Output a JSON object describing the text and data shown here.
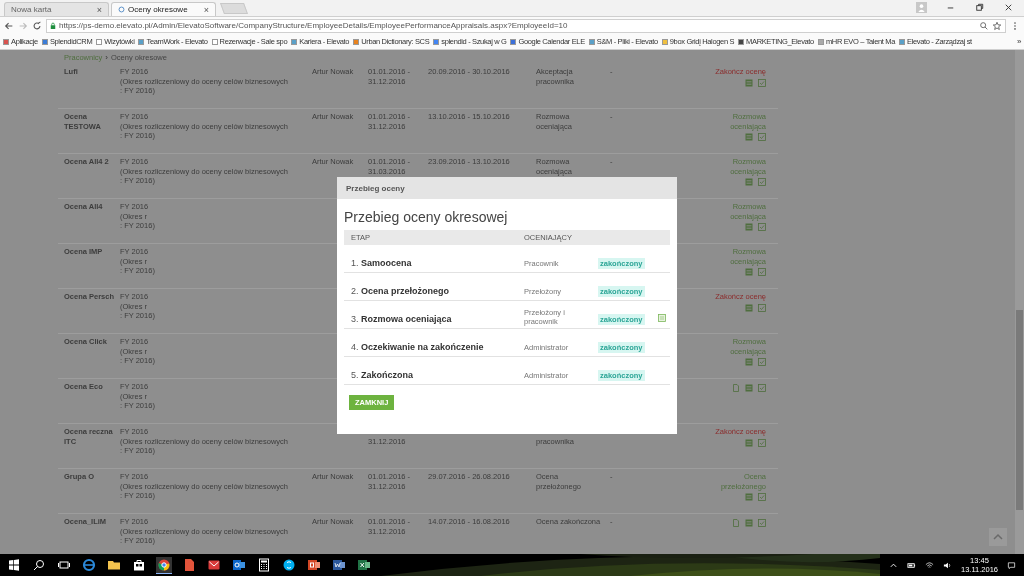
{
  "browser": {
    "tabs": [
      {
        "title": "Nowa karta",
        "close": "×",
        "selected": false
      },
      {
        "title": "Oceny okresowe",
        "close": "×",
        "selected": true
      }
    ],
    "url": "https://ps-demo.elevato.pl/Admin/ElevatoSoftware/CompanyStructure/EmployeeDetails/EmployeePerformanceAppraisals.aspx?EmployeeId=10",
    "bookmarks": [
      {
        "label": "Aplikacje",
        "color": "#d9534f"
      },
      {
        "label": "SplendidCRM",
        "color": "#3b7dd8"
      },
      {
        "label": "Wizytówki",
        "color": "#ffffff"
      },
      {
        "label": "TeamWork - Elevato",
        "color": "#5aa0c8"
      },
      {
        "label": "Rezerwacje - Sale spo",
        "color": "#ffffff"
      },
      {
        "label": "Kariera - Elevato",
        "color": "#5aa0c8"
      },
      {
        "label": "Urban Dictionary: SCS",
        "color": "#e8821e"
      },
      {
        "label": "splendid - Szukaj w G",
        "color": "#4285f4"
      },
      {
        "label": "Google Calendar ELE",
        "color": "#3b6fd8"
      },
      {
        "label": "S&M - Pliki - Elevato",
        "color": "#5aa0c8"
      },
      {
        "label": "9box Gridį Halogen S",
        "color": "#f0c040"
      },
      {
        "label": "MARKETING_Elevato",
        "color": "#444444"
      },
      {
        "label": "mHR EVO – Talent Ma",
        "color": "#aaaaaa"
      },
      {
        "label": "Elevato - Zarządzaj st",
        "color": "#5aa0c8"
      }
    ],
    "more": "»"
  },
  "breadcrumb": {
    "link": "Pracownicy",
    "separator": "›",
    "current": "Oceny okresowe"
  },
  "rows": [
    {
      "name": "Lufi",
      "period": [
        "FY 2016",
        "(Okres rozliczeniowy do oceny celów biznesowych",
        ": FY 2016)"
      ],
      "evaluator": "Artur Nowak",
      "dates": [
        "01.01.2016 -",
        "31.12.2016"
      ],
      "range": "20.09.2016 - 30.10.2016",
      "stage": [
        "Akceptacja",
        "pracownika"
      ],
      "dash": "-",
      "status": {
        "kind": "action",
        "text": "Zakończ ocenę"
      },
      "actions": [
        {
          "kind": "list"
        },
        {
          "kind": "check"
        }
      ]
    },
    {
      "name": "Ocena TESTOWA",
      "period": [
        "FY 2016",
        "(Okres rozliczeniowy do oceny celów biznesowych",
        ": FY 2016)"
      ],
      "evaluator": "Artur Nowak",
      "dates": [
        "01.01.2016 -",
        "31.12.2016"
      ],
      "range": "13.10.2016 - 15.10.2016",
      "stage": [
        "Rozmowa",
        "oceniająca"
      ],
      "dash": "-",
      "status": {
        "kind": "stage",
        "text": "Rozmowa oceniająca"
      },
      "actions": [
        {
          "kind": "list"
        },
        {
          "kind": "check"
        }
      ]
    },
    {
      "name": "Ocena All4 2",
      "period": [
        "FY 2016",
        "(Okres rozliczeniowy do oceny celów biznesowych",
        ": FY 2016)"
      ],
      "evaluator": "Artur Nowak",
      "dates": [
        "01.01.2016 -",
        "31.03.2016"
      ],
      "range": "23.09.2016 - 13.10.2016",
      "stage": [
        "Rozmowa",
        "oceniająca"
      ],
      "dash": "-",
      "status": {
        "kind": "stage",
        "text": "Rozmowa oceniająca"
      },
      "actions": [
        {
          "kind": "list"
        },
        {
          "kind": "check"
        }
      ]
    },
    {
      "name": "Ocena All4",
      "period": [
        "FY 2016",
        "(Okres r",
        ": FY 2016)"
      ],
      "status": {
        "kind": "stage",
        "text": "Rozmowa oceniająca"
      },
      "actions": [
        {
          "kind": "list"
        },
        {
          "kind": "check"
        }
      ]
    },
    {
      "name": "Ocena IMP",
      "period": [
        "FY 2016",
        "(Okres r",
        ": FY 2016)"
      ],
      "status": {
        "kind": "stage",
        "text": "Rozmowa oceniająca"
      },
      "actions": [
        {
          "kind": "list"
        },
        {
          "kind": "check"
        }
      ]
    },
    {
      "name": "Ocena Persch",
      "period": [
        "FY 2016",
        "(Okres r",
        ": FY 2016)"
      ],
      "status": {
        "kind": "action",
        "text": "Zakończ ocenę"
      },
      "actions": [
        {
          "kind": "list"
        },
        {
          "kind": "check"
        }
      ]
    },
    {
      "name": "Ocena Click",
      "period": [
        "FY 2016",
        "(Okres r",
        ": FY 2016)"
      ],
      "status": {
        "kind": "stage",
        "text": "Rozmowa oceniająca"
      },
      "actions": [
        {
          "kind": "list"
        },
        {
          "kind": "check"
        }
      ]
    },
    {
      "name": "Ocena Eco",
      "period": [
        "FY 2016",
        "(Okres r",
        ": FY 2016)"
      ],
      "actions": [
        {
          "kind": "doc"
        },
        {
          "kind": "list"
        },
        {
          "kind": "check"
        }
      ]
    },
    {
      "name": "Ocena reczna ITC",
      "period": [
        "FY 2016",
        "(Okres rozliczeniowy do oceny celów biznesowych",
        ": FY 2016)"
      ],
      "partly_covered": true,
      "dates": [
        "31.12.2016"
      ],
      "stage": [
        "pracownika"
      ],
      "status": {
        "kind": "action",
        "text": "Zakończ ocenę"
      },
      "actions": [
        {
          "kind": "list"
        },
        {
          "kind": "check"
        }
      ]
    },
    {
      "name": "Grupa O",
      "period": [
        "FY 2016",
        "(Okres rozliczeniowy do oceny celów biznesowych",
        ": FY 2016)"
      ],
      "evaluator": "Artur Nowak",
      "dates": [
        "01.01.2016 -",
        "31.12.2016"
      ],
      "range": "29.07.2016 - 26.08.2016",
      "stage": [
        "Ocena",
        "przełożonego"
      ],
      "dash": "-",
      "status": {
        "kind": "stage",
        "text": "Ocena przełożonego"
      },
      "actions": [
        {
          "kind": "list"
        },
        {
          "kind": "check"
        }
      ]
    },
    {
      "name": "Ocena_ILiM",
      "period": [
        "FY 2016",
        "(Okres rozliczeniowy do oceny celów biznesowych",
        ": FY 2016)"
      ],
      "evaluator": "Artur Nowak",
      "dates": [
        "01.01.2016 -",
        "31.12.2016"
      ],
      "range": "14.07.2016 - 16.08.2016",
      "stage": [
        "Ocena zakończona"
      ],
      "dash": "-",
      "actions": [
        {
          "kind": "doc"
        },
        {
          "kind": "list"
        },
        {
          "kind": "check"
        }
      ]
    }
  ],
  "modal": {
    "header": "Przebieg oceny",
    "title": "Przebieg oceny okresowej",
    "columns": [
      "ETAP",
      "OCENIAJĄCY"
    ],
    "steps": [
      {
        "number": "1.",
        "name": "Samoocena",
        "evaluator": "Pracownik",
        "status": "zakończony",
        "note": false
      },
      {
        "number": "2.",
        "name": "Ocena przełożonego",
        "evaluator": "Przełożony",
        "status": "zakończony",
        "note": false
      },
      {
        "number": "3.",
        "name": "Rozmowa oceniająca",
        "evaluator": "Przełożony i pracownik",
        "status": "zakończony",
        "note": true
      },
      {
        "number": "4.",
        "name": "Oczekiwanie na zakończenie",
        "evaluator": "Administrator",
        "status": "zakończony",
        "note": false
      },
      {
        "number": "5.",
        "name": "Zakończona",
        "evaluator": "Administrator",
        "status": "zakończony",
        "note": false
      }
    ],
    "button": "ZAMKNIJ"
  },
  "taskbar": {
    "time": "13:45",
    "date": "13.11.2016"
  }
}
